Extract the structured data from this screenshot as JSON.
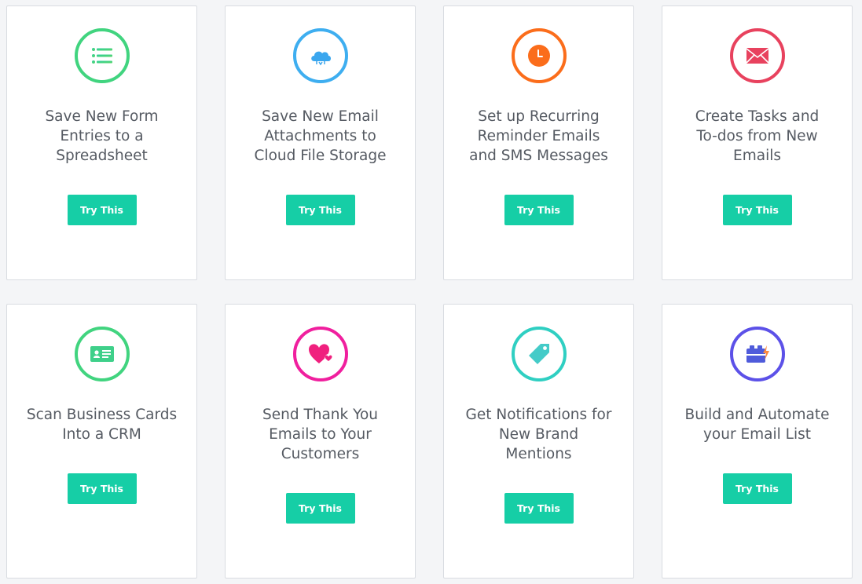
{
  "cards": [
    {
      "title": "Save New Form\nEntries to a\nSpreadsheet",
      "button": "Try This",
      "icon": "list-icon",
      "color": "#41d47f"
    },
    {
      "title": "Save New Email\nAttachments to\nCloud File Storage",
      "button": "Try This",
      "icon": "cloud-icon",
      "color": "#3eaef0"
    },
    {
      "title": "Set up Recurring\nReminder Emails\nand SMS Messages",
      "button": "Try This",
      "icon": "clock-icon",
      "color": "#fb6d1b"
    },
    {
      "title": "Create Tasks and\nTo-dos from New\nEmails",
      "button": "Try This",
      "icon": "envelope-icon",
      "color": "#e8425e"
    },
    {
      "title": "Scan Business Cards\nInto a CRM",
      "button": "Try This",
      "icon": "id-card-icon",
      "color": "#41d47f"
    },
    {
      "title": "Send Thank You\nEmails to Your\nCustomers",
      "button": "Try This",
      "icon": "heart-icon",
      "color": "#f01f9e"
    },
    {
      "title": "Get Notifications for\nNew Brand\nMentions",
      "button": "Try This",
      "icon": "tag-icon",
      "color": "#2fcfc2"
    },
    {
      "title": "Build and Automate\nyour Email List",
      "button": "Try This",
      "icon": "toolbox-icon",
      "color": "#5c51e8"
    }
  ]
}
